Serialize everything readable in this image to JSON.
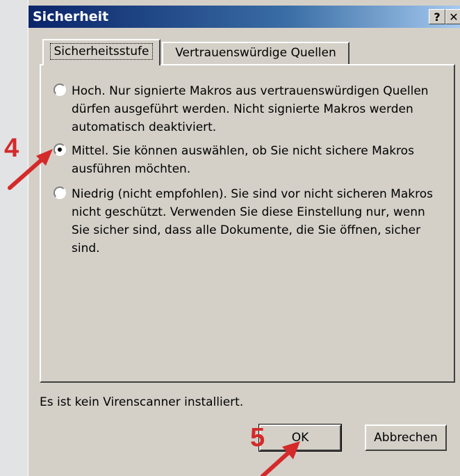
{
  "dialog": {
    "title": "Sicherheit",
    "help_button": "?",
    "close_button": "✕"
  },
  "tabs": [
    {
      "label": "Sicherheitsstufe",
      "active": true
    },
    {
      "label": "Vertrauenswürdige Quellen",
      "active": false
    }
  ],
  "options": [
    {
      "label": "Hoch. Nur signierte Makros aus vertrauenswürdigen Quellen dürfen ausgeführt werden.  Nicht signierte Makros werden automatisch deaktiviert.",
      "selected": false
    },
    {
      "label": "Mittel. Sie können auswählen, ob Sie nicht sichere Makros ausführen möchten.",
      "selected": true
    },
    {
      "label": "Niedrig (nicht empfohlen). Sie sind vor nicht sicheren Makros nicht geschützt. Verwenden Sie diese Einstellung nur, wenn Sie sicher sind, dass alle Dokumente, die Sie öffnen, sicher sind.",
      "selected": false
    }
  ],
  "status_text": "Es ist kein Virenscanner installiert.",
  "buttons": {
    "ok": "OK",
    "cancel": "Abbrechen"
  },
  "annotations": {
    "step4": "4",
    "step5": "5",
    "color": "#d42a2a"
  }
}
